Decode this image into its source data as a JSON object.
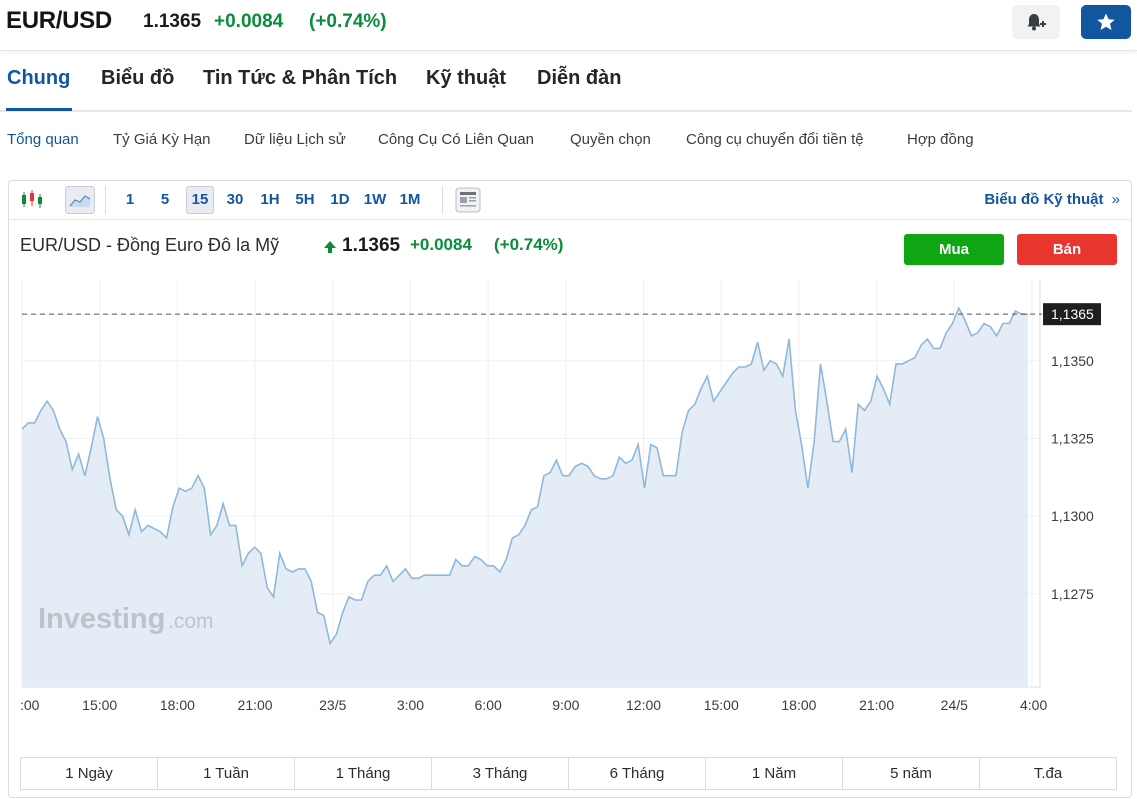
{
  "header": {
    "symbol": "EUR/USD",
    "price": "1.1365",
    "change": "+0.0084",
    "change_pct": "(+0.74%)"
  },
  "nav": {
    "tabs": [
      {
        "label": "Chung",
        "active": true
      },
      {
        "label": "Biểu đồ"
      },
      {
        "label": "Tin Tức & Phân Tích"
      },
      {
        "label": "Kỹ thuật"
      },
      {
        "label": "Diễn đàn"
      }
    ]
  },
  "subnav": {
    "items": [
      {
        "label": "Tổng quan",
        "active": true
      },
      {
        "label": "Tỷ Giá Kỳ Hạn"
      },
      {
        "label": "Dữ liệu Lịch sử"
      },
      {
        "label": "Công Cụ Có Liên Quan"
      },
      {
        "label": "Quyền chọn"
      },
      {
        "label": "Công cụ chuyển đổi tiền tệ"
      },
      {
        "label": "Hợp đồng"
      }
    ]
  },
  "toolbar": {
    "timeframes": [
      "1",
      "5",
      "15",
      "30",
      "1H",
      "5H",
      "1D",
      "1W",
      "1M"
    ],
    "selected": "15",
    "advanced_label": "Biểu đồ Kỹ thuật",
    "advanced_icon": "double-chevron-right-icon"
  },
  "chart_header": {
    "title": "EUR/USD - Đồng Euro Đô la Mỹ",
    "price": "1.1365",
    "change": "+0.0084",
    "change_pct": "(+0.74%)",
    "buy_label": "Mua",
    "sell_label": "Bán"
  },
  "colors": {
    "accent": "#1256a0",
    "up": "#0a8d3a",
    "buy": "#10a512",
    "sell": "#e8352d",
    "line": "#8fb8da",
    "fill": "#e4edf6"
  },
  "watermark": {
    "brand": "Investing",
    "suffix": ".com"
  },
  "chart_data": {
    "type": "area",
    "current_label": "1,1365",
    "current_value": 1.1365,
    "ylim": [
      1.1245,
      1.1376
    ],
    "y_ticks": [
      {
        "value": 1.135,
        "label": "1,1350"
      },
      {
        "value": 1.1325,
        "label": "1,1325"
      },
      {
        "value": 1.13,
        "label": "1,1300"
      },
      {
        "value": 1.1275,
        "label": "1,1275"
      }
    ],
    "x_ticks": [
      ":00",
      "15:00",
      "18:00",
      "21:00",
      "23/5",
      "3:00",
      "6:00",
      "9:00",
      "12:00",
      "15:00",
      "18:00",
      "21:00",
      "24/5",
      "4:00"
    ],
    "values": [
      1.1328,
      1.133,
      1.133,
      1.1334,
      1.1337,
      1.1334,
      1.1328,
      1.1324,
      1.1315,
      1.132,
      1.1313,
      1.1322,
      1.1332,
      1.1325,
      1.1312,
      1.1302,
      1.13,
      1.1294,
      1.1302,
      1.1295,
      1.1297,
      1.1296,
      1.1295,
      1.1293,
      1.1303,
      1.1309,
      1.1308,
      1.1309,
      1.1313,
      1.1309,
      1.1294,
      1.1297,
      1.1304,
      1.1297,
      1.1297,
      1.1284,
      1.1288,
      1.129,
      1.1288,
      1.1277,
      1.1274,
      1.1288,
      1.1283,
      1.1282,
      1.1283,
      1.1283,
      1.1279,
      1.1269,
      1.1268,
      1.1259,
      1.1262,
      1.1269,
      1.1274,
      1.1273,
      1.1273,
      1.1279,
      1.1281,
      1.1281,
      1.1284,
      1.1279,
      1.1281,
      1.1283,
      1.128,
      1.128,
      1.1281,
      1.1281,
      1.1281,
      1.1281,
      1.1281,
      1.1286,
      1.1284,
      1.1284,
      1.1287,
      1.1286,
      1.1284,
      1.1284,
      1.1282,
      1.1286,
      1.1293,
      1.1294,
      1.1297,
      1.1302,
      1.1303,
      1.1313,
      1.1314,
      1.1318,
      1.1313,
      1.1313,
      1.1316,
      1.1317,
      1.1316,
      1.1313,
      1.1312,
      1.1312,
      1.1313,
      1.1319,
      1.1317,
      1.1318,
      1.1323,
      1.1309,
      1.1323,
      1.1322,
      1.1313,
      1.1313,
      1.1313,
      1.1327,
      1.1334,
      1.1336,
      1.1341,
      1.1345,
      1.1337,
      1.134,
      1.1343,
      1.1346,
      1.1348,
      1.1348,
      1.1349,
      1.1356,
      1.1347,
      1.135,
      1.1349,
      1.1345,
      1.1357,
      1.1334,
      1.1323,
      1.1309,
      1.1324,
      1.1349,
      1.1337,
      1.1324,
      1.1324,
      1.1328,
      1.1314,
      1.1336,
      1.1334,
      1.1337,
      1.1345,
      1.1341,
      1.1336,
      1.1349,
      1.1349,
      1.135,
      1.1351,
      1.1355,
      1.1357,
      1.1354,
      1.1354,
      1.1359,
      1.1362,
      1.1367,
      1.1363,
      1.1358,
      1.1359,
      1.1362,
      1.1361,
      1.1358,
      1.1362,
      1.1362,
      1.1366,
      1.1365,
      1.1365
    ]
  },
  "ranges": [
    "1 Ngày",
    "1 Tuần",
    "1 Tháng",
    "3 Tháng",
    "6 Tháng",
    "1 Năm",
    "5 năm",
    "T.đa"
  ]
}
